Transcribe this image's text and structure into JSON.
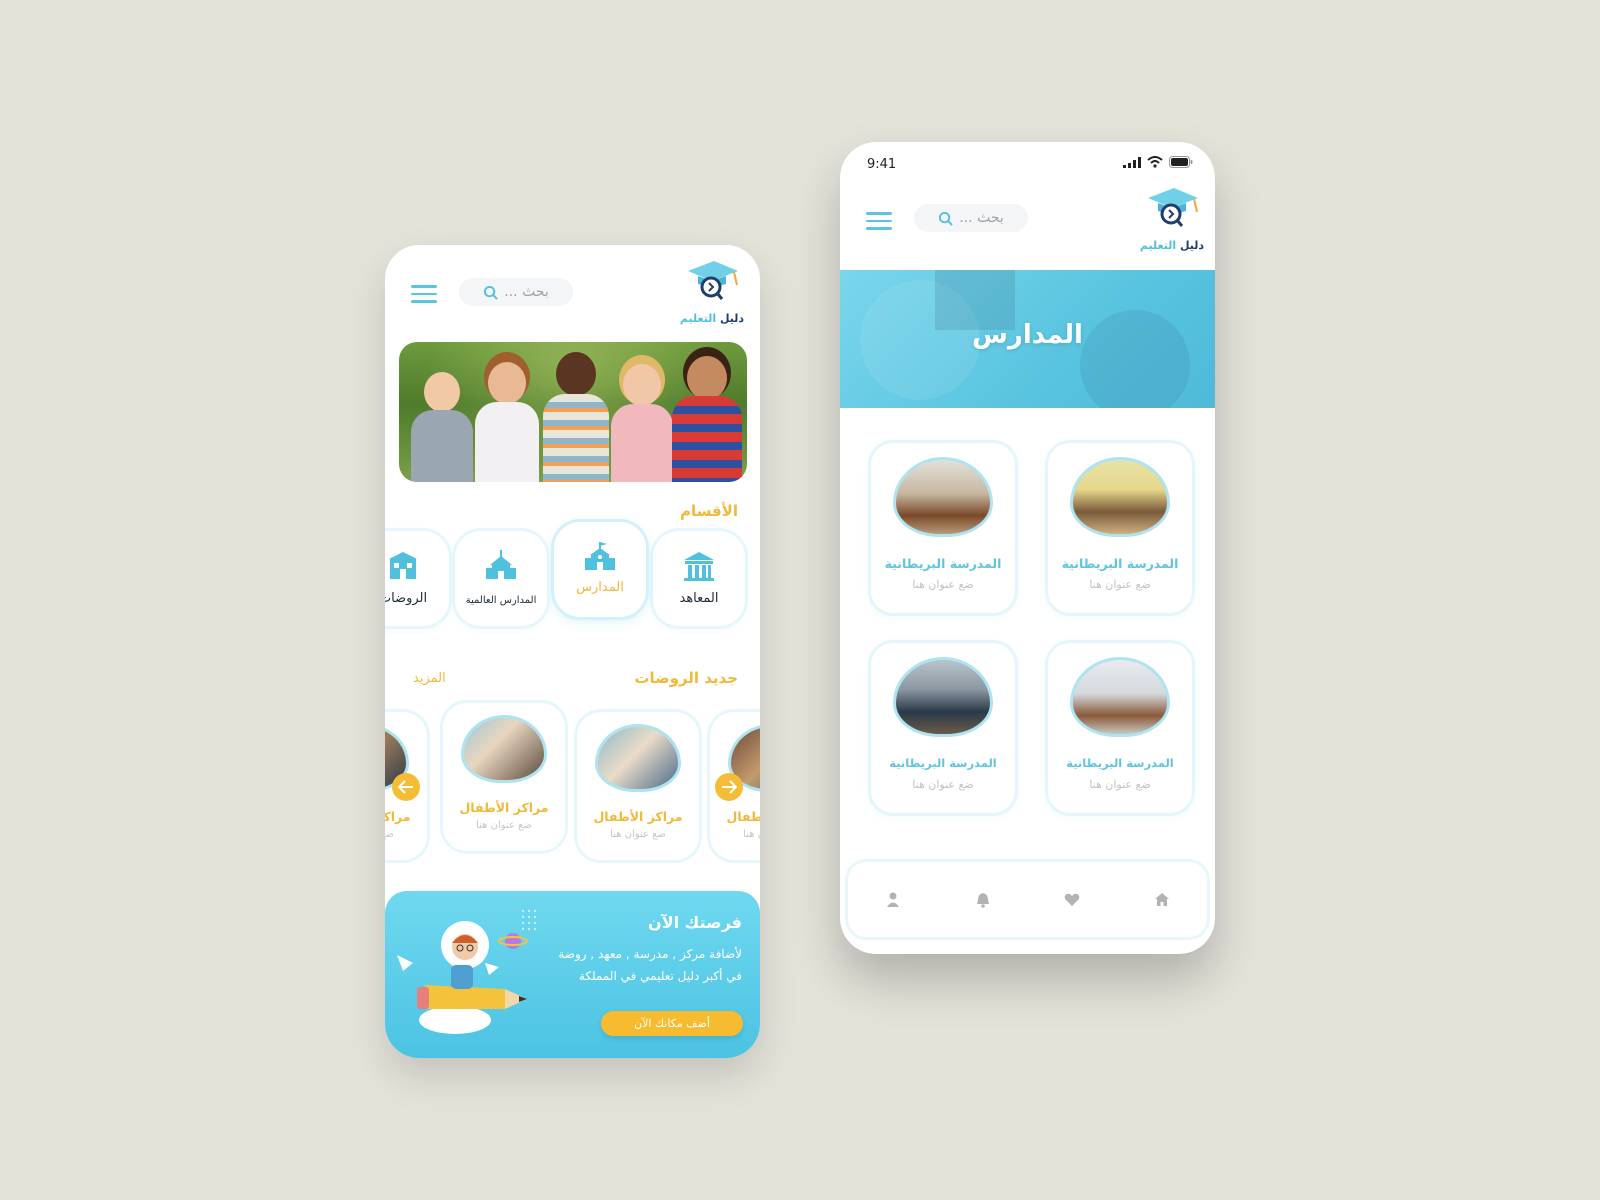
{
  "screen_left": {
    "search": {
      "placeholder": "بحث ..."
    },
    "logo": {
      "part1": "دليل",
      "part2": "التعليم"
    },
    "categories_title": "الأقسام",
    "categories": [
      {
        "label": "المعاهد",
        "icon": "institute-icon"
      },
      {
        "label": "المدارس",
        "icon": "school-icon"
      },
      {
        "label": "المدارس العالمية",
        "icon": "international-school-icon"
      },
      {
        "label": "الروضات",
        "icon": "kindergarten-icon"
      }
    ],
    "kindergartens": {
      "title": "جديد الروضات",
      "more": "المزيد",
      "cards": [
        {
          "title": "مراكز الأطفال",
          "subtitle": "ضع عنوان هنا"
        },
        {
          "title": "مراكز الأطفال",
          "subtitle": "ضع عنوان هنا"
        },
        {
          "title": "مراكز الأطفال",
          "subtitle": "ضع عنوان هنا"
        },
        {
          "title": "مراكز الأطفال",
          "subtitle": "ضع عنوان هنا"
        }
      ]
    },
    "promo": {
      "title": "فرصتك الآن",
      "line1": "لأضافة مركز , مدرسة , معهد , روضة",
      "line2": "في أكبر دليل تعليمي في المملكة",
      "button": "أضف مكانك الآن"
    }
  },
  "screen_right": {
    "status": {
      "time": "9:41"
    },
    "search": {
      "placeholder": "بحث ..."
    },
    "logo": {
      "part1": "دليل",
      "part2": "التعليم"
    },
    "banner_title": "المدارس",
    "schools": [
      {
        "title": "المدرسة البريطانية",
        "subtitle": "ضع عنوان هنا"
      },
      {
        "title": "المدرسة البريطانية",
        "subtitle": "ضع عنوان هنا"
      },
      {
        "title": "المدرسة البريطانية",
        "subtitle": "ضع عنوان هنا"
      },
      {
        "title": "المدرسة البريطانية",
        "subtitle": "ضع عنوان هنا"
      }
    ],
    "tabbar": [
      "profile-icon",
      "bell-icon",
      "heart-icon",
      "home-icon"
    ]
  },
  "colors": {
    "accent": "#4fc1de",
    "highlight": "#f0b93a",
    "background": "#e3e3da"
  }
}
